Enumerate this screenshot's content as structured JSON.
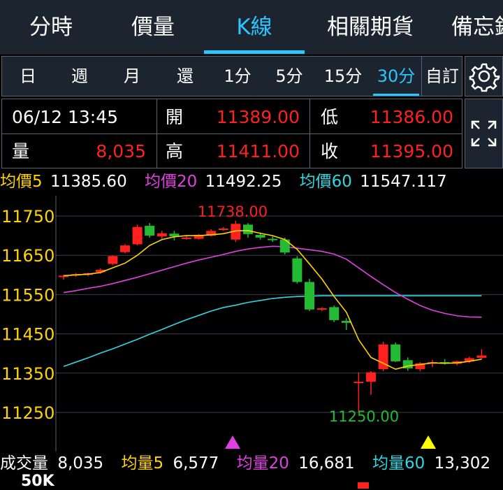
{
  "top_tabs": [
    "分時",
    "價量",
    "K線",
    "相關期貨",
    "備忘錄"
  ],
  "periods": [
    "日",
    "週",
    "月",
    "還",
    "1分",
    "5分",
    "15分",
    "30分",
    "自訂"
  ],
  "info": {
    "datetime": "06/12 13:45",
    "open_label": "開",
    "open": "11389.00",
    "low_label": "低",
    "low": "11386.00",
    "vol_label": "量",
    "volume": "8,035",
    "high_label": "高",
    "high": "11411.00",
    "close_label": "收",
    "close": "11395.00"
  },
  "ma": {
    "ma5_label": "均價5",
    "ma5": "11385.60",
    "ma20_label": "均價20",
    "ma20": "11492.25",
    "ma60_label": "均價60",
    "ma60": "11547.117"
  },
  "volume_row": {
    "label": "成交量",
    "value": "8,035",
    "v5_label": "均量5",
    "v5": "6,577",
    "v20_label": "均量20",
    "v20": "16,681",
    "v60_label": "均量60",
    "v60": "13,302"
  },
  "volume_axis_label": "50K",
  "colors": {
    "up": "#ff2020",
    "down": "#22bb33",
    "ma5": "#ffd400",
    "ma20": "#e040e0",
    "ma60": "#33d6e0",
    "accent": "#2cc6ff"
  },
  "chart_data": {
    "type": "candlestick",
    "yticks": [
      11750,
      11650,
      11550,
      11450,
      11350,
      11250
    ],
    "ylim": [
      11180,
      11800
    ],
    "max_label": "11738.00",
    "min_label": "11250.00",
    "candles": [
      {
        "o": 11595,
        "h": 11600,
        "l": 11588,
        "c": 11598
      },
      {
        "o": 11600,
        "h": 11605,
        "l": 11595,
        "c": 11602
      },
      {
        "o": 11600,
        "h": 11606,
        "l": 11597,
        "c": 11604
      },
      {
        "o": 11607,
        "h": 11617,
        "l": 11603,
        "c": 11613
      },
      {
        "o": 11628,
        "h": 11650,
        "l": 11625,
        "c": 11648
      },
      {
        "o": 11658,
        "h": 11678,
        "l": 11655,
        "c": 11675
      },
      {
        "o": 11678,
        "h": 11728,
        "l": 11675,
        "c": 11722
      },
      {
        "o": 11725,
        "h": 11732,
        "l": 11695,
        "c": 11700
      },
      {
        "o": 11698,
        "h": 11712,
        "l": 11692,
        "c": 11706
      },
      {
        "o": 11705,
        "h": 11712,
        "l": 11688,
        "c": 11698
      },
      {
        "o": 11695,
        "h": 11700,
        "l": 11690,
        "c": 11695
      },
      {
        "o": 11692,
        "h": 11704,
        "l": 11690,
        "c": 11702
      },
      {
        "o": 11700,
        "h": 11716,
        "l": 11698,
        "c": 11712
      },
      {
        "o": 11716,
        "h": 11722,
        "l": 11712,
        "c": 11718
      },
      {
        "o": 11690,
        "h": 11738,
        "l": 11684,
        "c": 11730
      },
      {
        "o": 11728,
        "h": 11732,
        "l": 11695,
        "c": 11704
      },
      {
        "o": 11702,
        "h": 11708,
        "l": 11690,
        "c": 11695
      },
      {
        "o": 11692,
        "h": 11698,
        "l": 11684,
        "c": 11690
      },
      {
        "o": 11690,
        "h": 11695,
        "l": 11652,
        "c": 11657
      },
      {
        "o": 11642,
        "h": 11648,
        "l": 11578,
        "c": 11582
      },
      {
        "o": 11582,
        "h": 11590,
        "l": 11508,
        "c": 11512
      },
      {
        "o": 11512,
        "h": 11518,
        "l": 11508,
        "c": 11515
      },
      {
        "o": 11518,
        "h": 11522,
        "l": 11480,
        "c": 11485
      },
      {
        "o": 11483,
        "h": 11490,
        "l": 11460,
        "c": 11478
      },
      {
        "o": 11325,
        "h": 11352,
        "l": 11250,
        "c": 11328
      },
      {
        "o": 11328,
        "h": 11355,
        "l": 11295,
        "c": 11352
      },
      {
        "o": 11360,
        "h": 11430,
        "l": 11355,
        "c": 11423
      },
      {
        "o": 11423,
        "h": 11428,
        "l": 11378,
        "c": 11380
      },
      {
        "o": 11383,
        "h": 11390,
        "l": 11356,
        "c": 11362
      },
      {
        "o": 11360,
        "h": 11378,
        "l": 11355,
        "c": 11375
      },
      {
        "o": 11375,
        "h": 11384,
        "l": 11365,
        "c": 11378
      },
      {
        "o": 11378,
        "h": 11386,
        "l": 11372,
        "c": 11374
      },
      {
        "o": 11374,
        "h": 11382,
        "l": 11370,
        "c": 11380
      },
      {
        "o": 11380,
        "h": 11392,
        "l": 11376,
        "c": 11388
      },
      {
        "o": 11389,
        "h": 11411,
        "l": 11386,
        "c": 11395
      }
    ],
    "ma5": [
      11598,
      11600,
      11602,
      11606,
      11618,
      11630,
      11650,
      11675,
      11690,
      11697,
      11700,
      11700,
      11702,
      11705,
      11712,
      11713,
      11706,
      11700,
      11690,
      11665,
      11628,
      11590,
      11545,
      11505,
      11435,
      11390,
      11375,
      11360,
      11368,
      11372,
      11376,
      11375,
      11376,
      11380,
      11385.6
    ],
    "ma20": [
      11555,
      11560,
      11566,
      11571,
      11578,
      11586,
      11594,
      11603,
      11612,
      11621,
      11630,
      11638,
      11645,
      11652,
      11660,
      11666,
      11670,
      11673,
      11672,
      11668,
      11664,
      11660,
      11653,
      11640,
      11618,
      11596,
      11575,
      11555,
      11538,
      11522,
      11510,
      11502,
      11496,
      11493,
      11492.25
    ],
    "ma60": [
      11367,
      11378,
      11389,
      11401,
      11412,
      11424,
      11436,
      11449,
      11461,
      11474,
      11486,
      11497,
      11508,
      11517,
      11523,
      11530,
      11535,
      11540,
      11543,
      11545,
      11546,
      11547,
      11547,
      11547,
      11547,
      11547,
      11547,
      11547,
      11547,
      11547,
      11547,
      11547,
      11547,
      11547,
      11547.117
    ]
  }
}
